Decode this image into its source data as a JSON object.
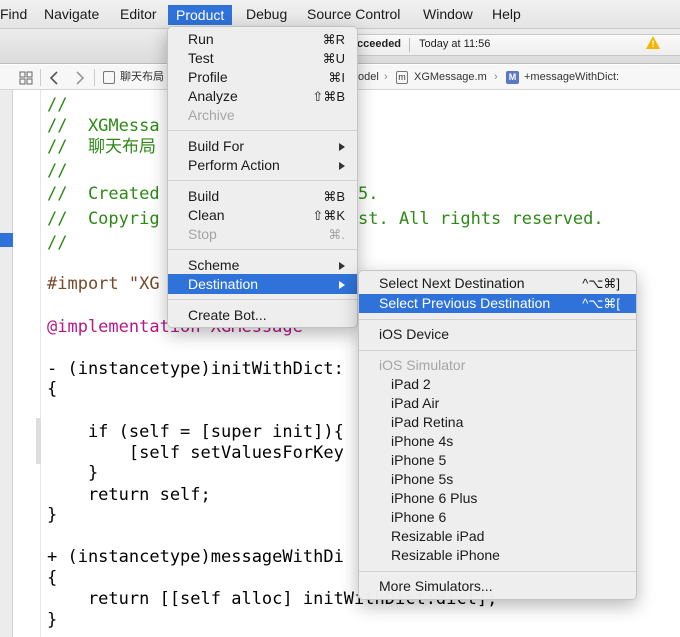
{
  "menubar": {
    "items": [
      "Find",
      "Navigate",
      "Editor",
      "Product",
      "Debug",
      "Source Control",
      "Window",
      "Help"
    ]
  },
  "toolbar": {
    "status_partial": "cceeded",
    "status_time": "Today at 11:56"
  },
  "jumpbar": {
    "file_group": "聊天布局",
    "model_partial": "odel",
    "file": "XGMessage.m",
    "method": "+messageWithDict:",
    "m_badge": "m",
    "M_badge": "M"
  },
  "code": [
    "//",
    "//  XGMessa",
    "//  聊天布局",
    "//",
    "//  Created",
    "//  Copyrig",
    "//",
    "#import \"XG",
    "@implementation XGMessage",
    "- (instancetype)initWithDict:",
    "{",
    "    if (self = [super init]){",
    "        [self setValuesForKey",
    "    }",
    "    return self;",
    "}",
    "+ (instancetype)messageWithDi",
    "{",
    "    return [[self alloc] initWithDict:dict];",
    "}"
  ],
  "code_right": {
    "created_tail": "5.",
    "copyright_tail": "st. All rights reserved."
  },
  "product_menu": {
    "run": {
      "label": "Run",
      "shortcut": "⌘R"
    },
    "test": {
      "label": "Test",
      "shortcut": "⌘U"
    },
    "profile": {
      "label": "Profile",
      "shortcut": "⌘I"
    },
    "analyze": {
      "label": "Analyze",
      "shortcut": "⇧⌘B"
    },
    "archive": {
      "label": "Archive"
    },
    "build_for": {
      "label": "Build For"
    },
    "perform_action": {
      "label": "Perform Action"
    },
    "build": {
      "label": "Build",
      "shortcut": "⌘B"
    },
    "clean": {
      "label": "Clean",
      "shortcut": "⇧⌘K"
    },
    "stop": {
      "label": "Stop",
      "shortcut": "⌘."
    },
    "scheme": {
      "label": "Scheme"
    },
    "destination": {
      "label": "Destination"
    },
    "create_bot": {
      "label": "Create Bot..."
    }
  },
  "destination_menu": {
    "next": {
      "label": "Select Next Destination",
      "shortcut": "^⌥⌘]"
    },
    "previous": {
      "label": "Select Previous Destination",
      "shortcut": "^⌥⌘["
    },
    "ios_device": "iOS Device",
    "simulator_header": "iOS Simulator",
    "simulators": [
      "iPad 2",
      "iPad Air",
      "iPad Retina",
      "iPhone 4s",
      "iPhone 5",
      "iPhone 5s",
      "iPhone 6 Plus",
      "iPhone 6",
      "Resizable iPad",
      "Resizable iPhone"
    ],
    "more": "More Simulators..."
  },
  "colors": {
    "highlight": "#2f72d9",
    "comment": "#2e8a17",
    "keyword": "#b21889",
    "warning": "#f5b400"
  }
}
